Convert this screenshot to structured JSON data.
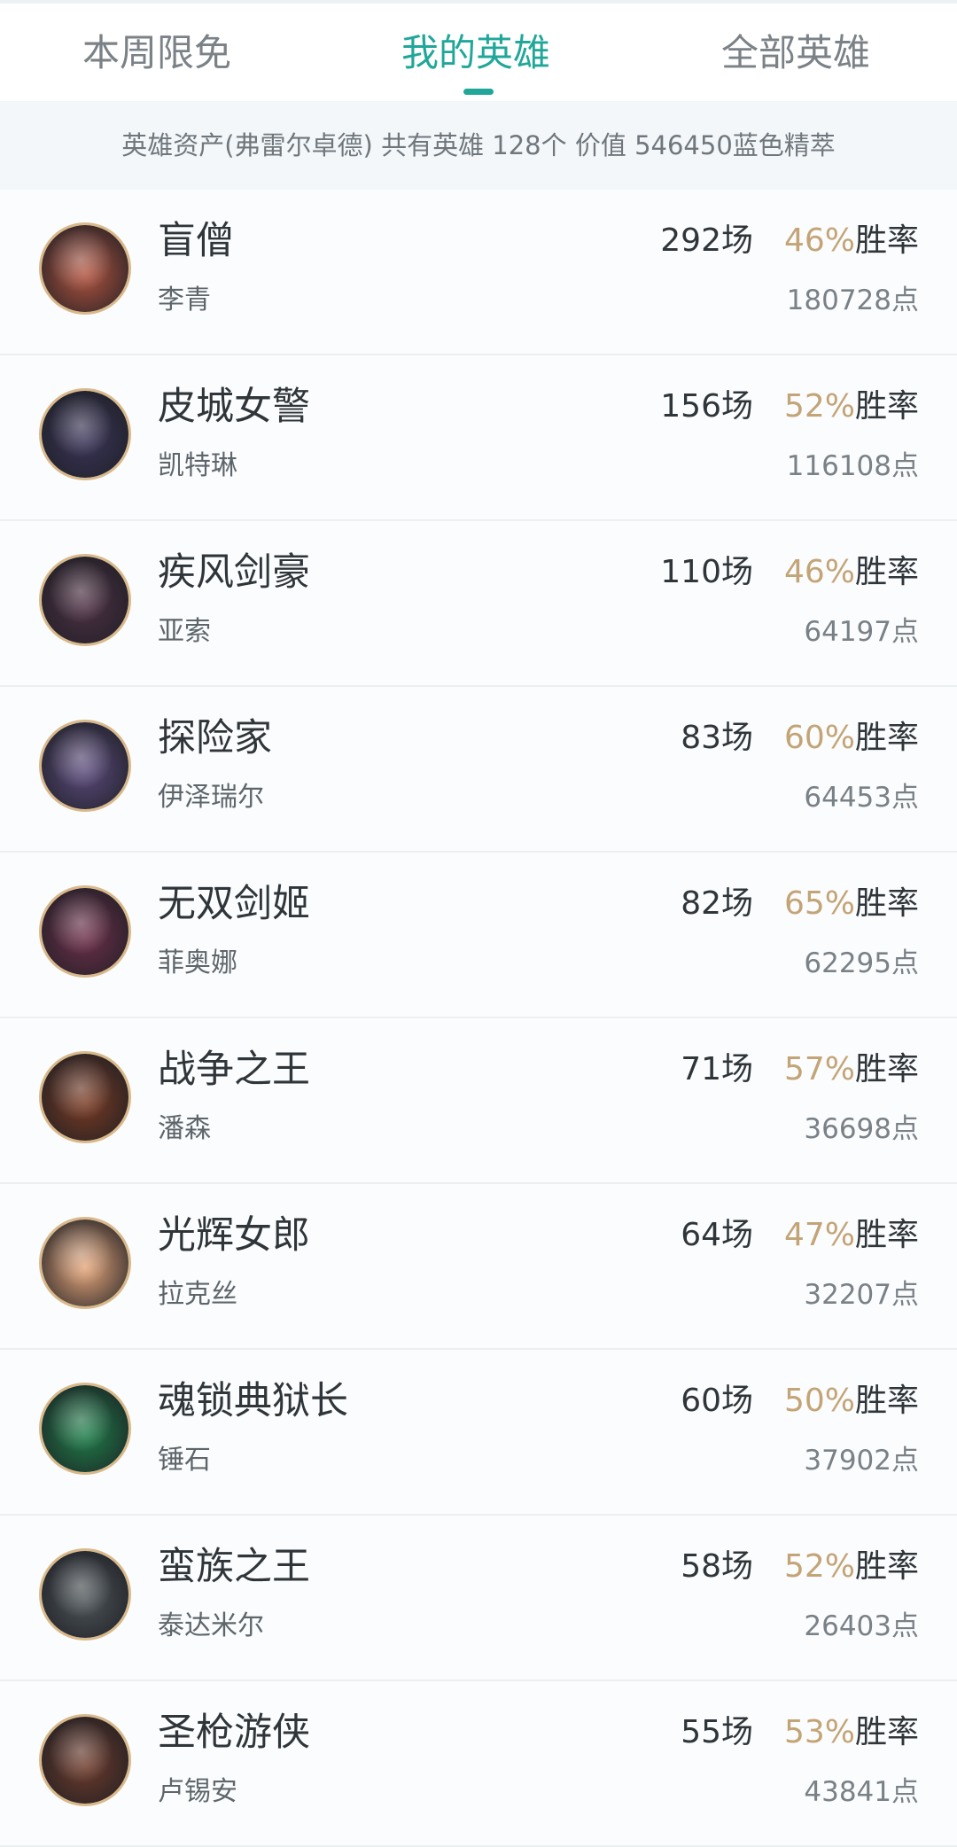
{
  "tabs": [
    {
      "label": "本周限免",
      "active": false
    },
    {
      "label": "我的英雄",
      "active": true
    },
    {
      "label": "全部英雄",
      "active": false
    }
  ],
  "summary": {
    "text": "英雄资产(弗雷尔卓德)  共有英雄 128个  价值 546450蓝色精萃"
  },
  "colors": {
    "accent": "#21a79a",
    "winrate": "#c3a477",
    "avatar_border": "#d9b98a"
  },
  "heroes": [
    {
      "title": "盲僧",
      "name": "李青",
      "games": "292场",
      "winrate": "46%",
      "winrate_label": "胜率",
      "points": "180728点",
      "avatar_icon": "lee-sin-portrait-icon",
      "avatar_color": "#b3543f"
    },
    {
      "title": "皮城女警",
      "name": "凯特琳",
      "games": "156场",
      "winrate": "52%",
      "winrate_label": "胜率",
      "points": "116108点",
      "avatar_icon": "caitlyn-portrait-icon",
      "avatar_color": "#3a3458"
    },
    {
      "title": "疾风剑豪",
      "name": "亚索",
      "games": "110场",
      "winrate": "46%",
      "winrate_label": "胜率",
      "points": "64197点",
      "avatar_icon": "yasuo-portrait-icon",
      "avatar_color": "#4d2f43"
    },
    {
      "title": "探险家",
      "name": "伊泽瑞尔",
      "games": "83场",
      "winrate": "60%",
      "winrate_label": "胜率",
      "points": "64453点",
      "avatar_icon": "ezreal-portrait-icon",
      "avatar_color": "#5b4a7c"
    },
    {
      "title": "无双剑姬",
      "name": "菲奥娜",
      "games": "82场",
      "winrate": "65%",
      "winrate_label": "胜率",
      "points": "62295点",
      "avatar_icon": "fiora-portrait-icon",
      "avatar_color": "#6f2f4a"
    },
    {
      "title": "战争之王",
      "name": "潘森",
      "games": "71场",
      "winrate": "57%",
      "winrate_label": "胜率",
      "points": "36698点",
      "avatar_icon": "pantheon-portrait-icon",
      "avatar_color": "#7a3a22"
    },
    {
      "title": "光辉女郎",
      "name": "拉克丝",
      "games": "64场",
      "winrate": "47%",
      "winrate_label": "胜率",
      "points": "32207点",
      "avatar_icon": "lux-portrait-icon",
      "avatar_color": "#e6a67a"
    },
    {
      "title": "魂锁典狱长",
      "name": "锤石",
      "games": "60场",
      "winrate": "50%",
      "winrate_label": "胜率",
      "points": "37902点",
      "avatar_icon": "thresh-portrait-icon",
      "avatar_color": "#1e7f4a"
    },
    {
      "title": "蛮族之王",
      "name": "泰达米尔",
      "games": "58场",
      "winrate": "52%",
      "winrate_label": "胜率",
      "points": "26403点",
      "avatar_icon": "tryndamere-portrait-icon",
      "avatar_color": "#4d5458"
    },
    {
      "title": "圣枪游侠",
      "name": "卢锡安",
      "games": "55场",
      "winrate": "53%",
      "winrate_label": "胜率",
      "points": "43841点",
      "avatar_icon": "lucian-portrait-icon",
      "avatar_color": "#6e3a2a"
    }
  ]
}
